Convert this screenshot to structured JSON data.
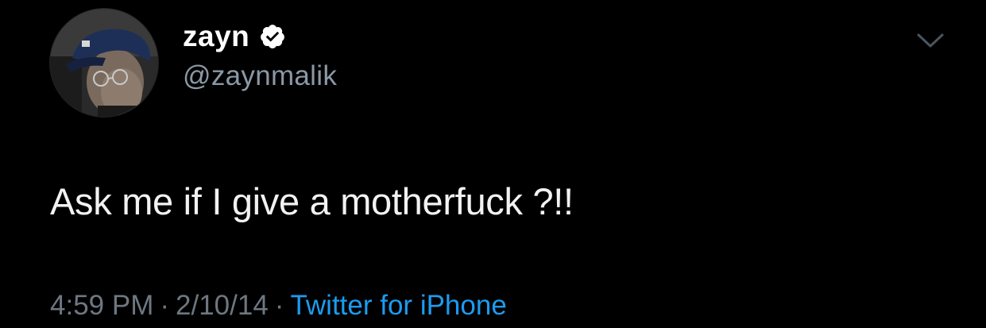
{
  "user": {
    "display_name": "zayn",
    "handle": "@zaynmalik",
    "verified_icon": "verified-badge-icon"
  },
  "tweet": {
    "text": "Ask me if I give a motherfuck ?!!",
    "time": "4:59 PM",
    "separator": "·",
    "date": "2/10/14",
    "source": "Twitter for iPhone"
  },
  "icons": {
    "menu": "chevron-down-icon"
  },
  "colors": {
    "background": "#000000",
    "name": "#ffffff",
    "handle": "#8b98a5",
    "meta": "#6e7781",
    "link": "#1d9bf0"
  }
}
